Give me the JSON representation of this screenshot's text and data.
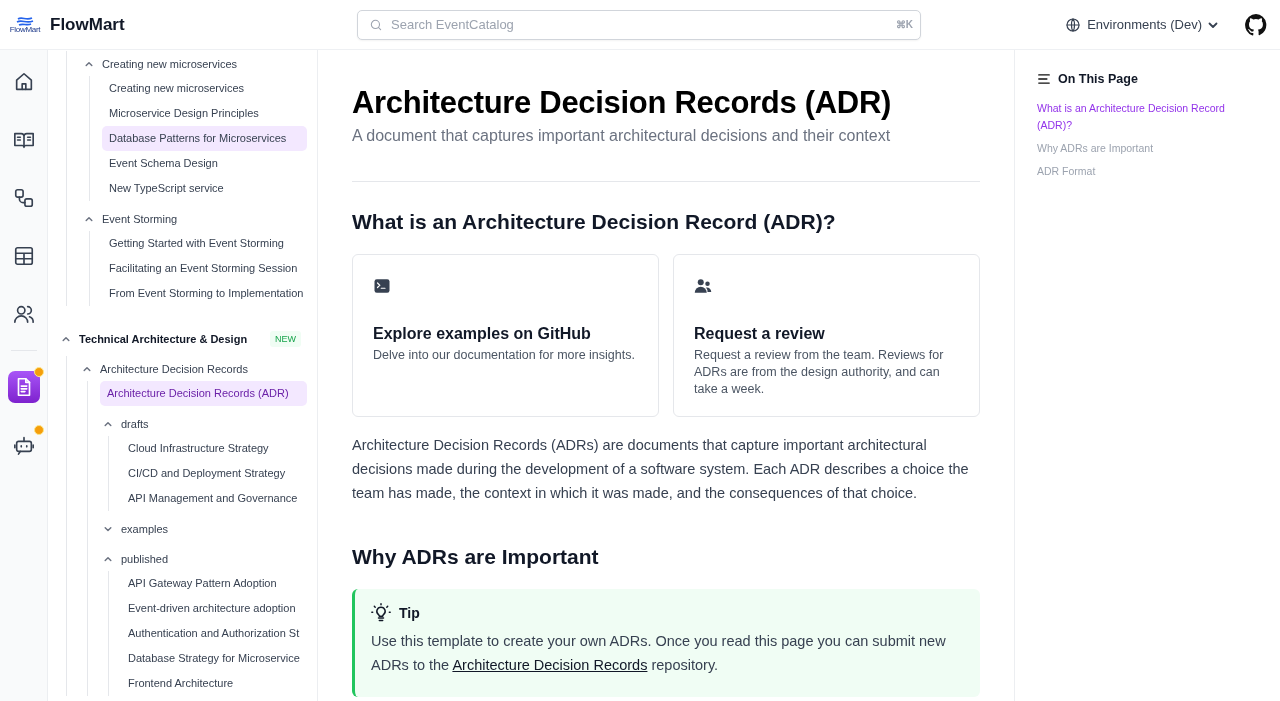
{
  "header": {
    "brand": "FlowMart",
    "logo_caption": "FlowMart",
    "search": {
      "placeholder": "Search EventCatalog",
      "shortcut": "⌘K"
    },
    "environment": "Environments (Dev)"
  },
  "rail": {
    "primary": [
      {
        "selected": false,
        "badge": false
      },
      {
        "selected": false,
        "badge": false
      },
      {
        "selected": false,
        "badge": false
      },
      {
        "selected": false,
        "badge": false
      },
      {
        "selected": false,
        "badge": false
      }
    ],
    "secondary": [
      {
        "selected": true,
        "badge": true
      },
      {
        "selected": false,
        "badge": true
      }
    ]
  },
  "sidebar": {
    "tree": [
      {
        "children": [
          {
            "label": "Creating new microservices",
            "expanded": true,
            "children": [
              {
                "label": "Creating new microservices",
                "selected": false,
                "highlighted": false
              },
              {
                "label": "Microservice Design Principles",
                "selected": false,
                "highlighted": false
              },
              {
                "label": "Database Patterns for Microservices",
                "selected": false,
                "highlighted": true
              },
              {
                "label": "Event Schema Design",
                "selected": false,
                "highlighted": false
              },
              {
                "label": "New TypeScript service",
                "selected": false,
                "highlighted": false
              }
            ]
          },
          {
            "label": "Event Storming",
            "expanded": true,
            "children": [
              {
                "label": "Getting Started with Event Storming",
                "selected": false,
                "highlighted": false
              },
              {
                "label": "Facilitating an Event Storming Session",
                "selected": false,
                "highlighted": false
              },
              {
                "label": "From Event Storming to Implementation",
                "selected": false,
                "highlighted": false
              }
            ]
          }
        ]
      },
      {
        "label": "Technical Architecture & Design",
        "expanded": true,
        "badge": "NEW",
        "children": [
          {
            "label": "Architecture Decision Records",
            "expanded": true,
            "children": [
              {
                "label": "Architecture Decision Records (ADR)",
                "selected": true,
                "highlighted": true
              },
              {
                "label": "drafts",
                "expanded": true,
                "children": [
                  {
                    "label": "Cloud Infrastructure Strategy",
                    "selected": false,
                    "highlighted": false
                  },
                  {
                    "label": "CI/CD and Deployment Strategy",
                    "selected": false,
                    "highlighted": false
                  },
                  {
                    "label": "API Management and Governance",
                    "selected": false,
                    "highlighted": false
                  }
                ]
              },
              {
                "label": "examples",
                "expanded": false
              },
              {
                "label": "published",
                "expanded": true,
                "children": [
                  {
                    "label": "API Gateway Pattern Adoption",
                    "selected": false,
                    "highlighted": false
                  },
                  {
                    "label": "Event-driven architecture adoption",
                    "selected": false,
                    "highlighted": false
                  },
                  {
                    "label": "Authentication and Authorization St",
                    "selected": false,
                    "highlighted": false
                  },
                  {
                    "label": "Database Strategy for Microservice",
                    "selected": false,
                    "highlighted": false
                  },
                  {
                    "label": "Frontend Architecture",
                    "selected": false,
                    "highlighted": false
                  }
                ]
              }
            ]
          }
        ]
      }
    ]
  },
  "article": {
    "title": "Architecture Decision Records (ADR)",
    "subtitle": "A document that captures important architectural decisions and their context",
    "section_1": {
      "heading": "What is an Architecture Decision Record (ADR)?",
      "cards": [
        {
          "kind": "terminal",
          "title": "Explore examples on GitHub",
          "text": "Delve into our documentation for more insights."
        },
        {
          "kind": "people",
          "title": "Request a review",
          "text": "Request a review from the team. Reviews for ADRs are from the design authority, and can take a week."
        }
      ],
      "paragraph": "Architecture Decision Records (ADRs) are documents that capture important architectural decisions made during the development of a software system. Each ADR describes a choice the team has made, the context in which it was made, and the consequences of that choice."
    },
    "section_2": {
      "heading": "Why ADRs are Important",
      "tip": {
        "title": "Tip",
        "text_before": "Use this template to create your own ADRs. Once you read this page you can submit new ADRs to the ",
        "link": "Architecture Decision Records",
        "text_after": " repository."
      }
    }
  },
  "toc": {
    "title": "On This Page",
    "items": [
      {
        "label": "What is an Architecture Decision Record (ADR)?",
        "selected": true
      },
      {
        "label": "Why ADRs are Important",
        "selected": false
      },
      {
        "label": "ADR Format",
        "selected": false
      }
    ]
  }
}
